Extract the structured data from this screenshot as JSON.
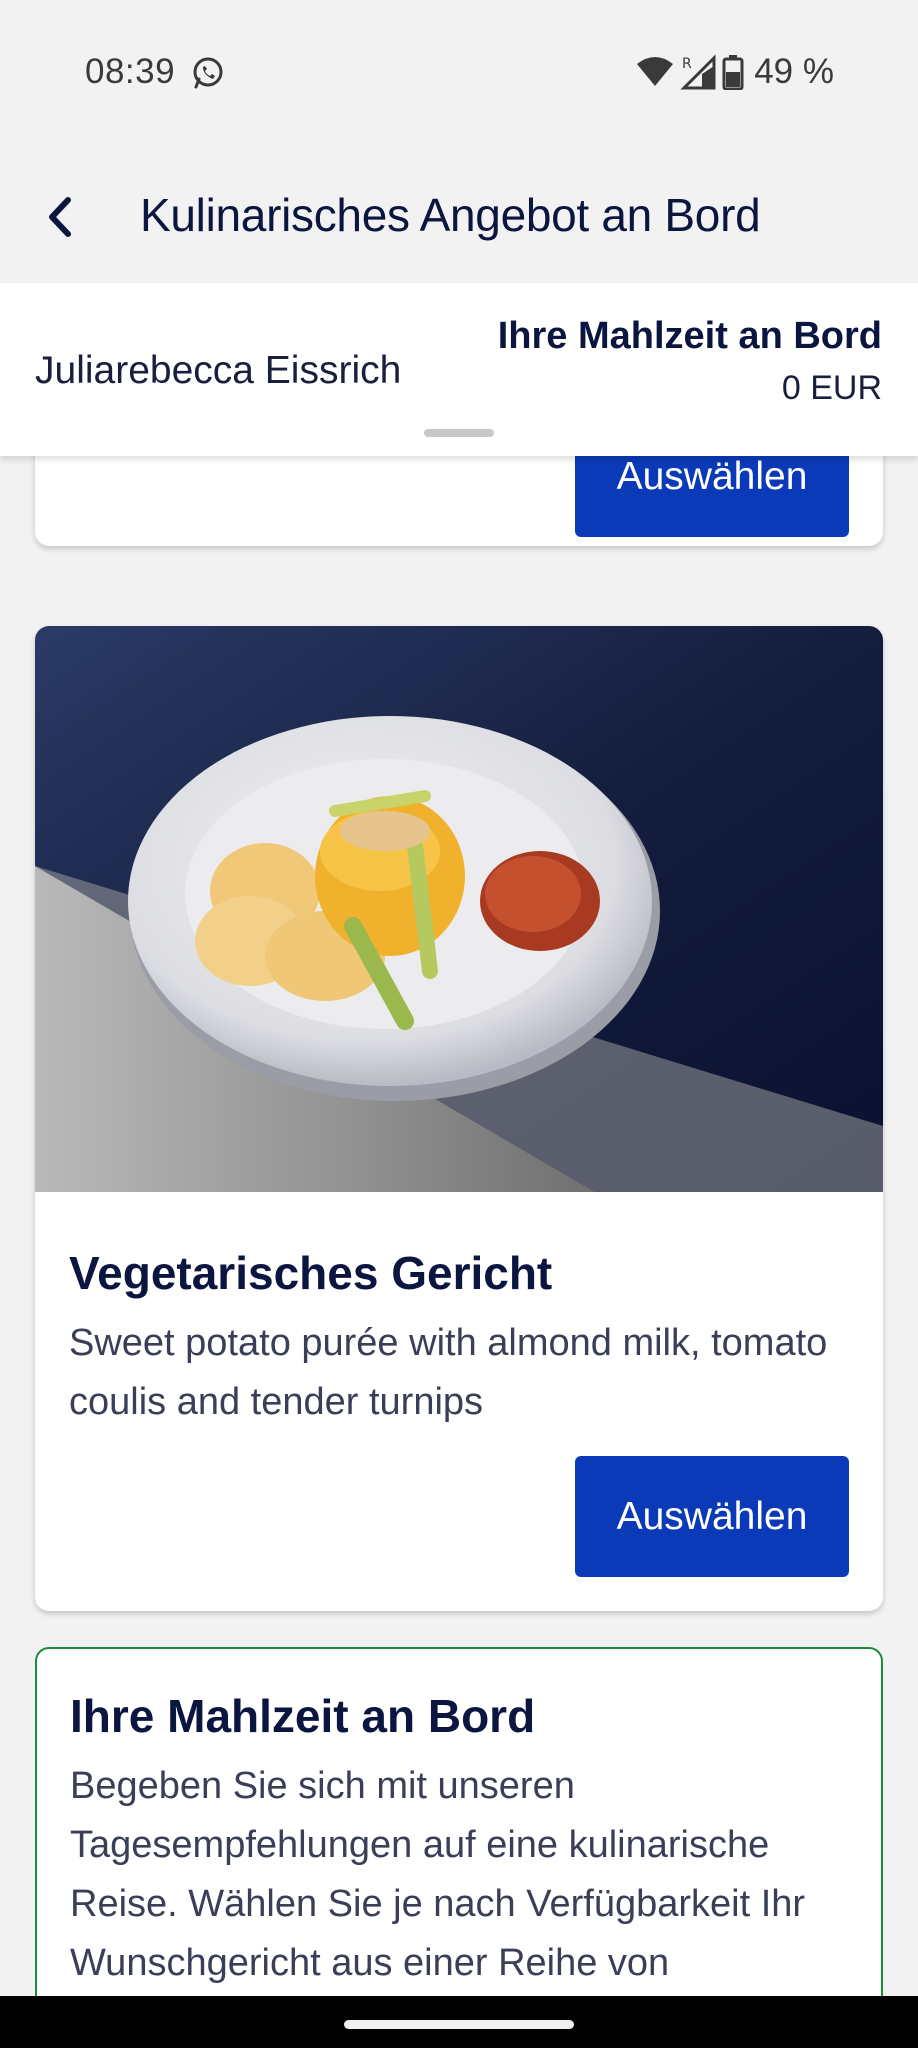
{
  "status_bar": {
    "time": "08:39",
    "battery_percent": "49 %",
    "icons": [
      "whatsapp-icon",
      "wifi-icon",
      "signal-roaming-icon",
      "battery-icon"
    ]
  },
  "app_bar": {
    "title": "Kulinarisches Angebot an Bord",
    "back_icon": "chevron-left-icon"
  },
  "summary": {
    "passenger_name": "Juliarebecca Eissrich",
    "meal_title": "Ihre Mahlzeit an Bord",
    "price": "0 EUR"
  },
  "cards": [
    {
      "button_label": "Auswählen"
    },
    {
      "title": "Vegetarisches Gericht",
      "description": "Sweet potato purée with almond milk, tomato coulis and tender turnips",
      "button_label": "Auswählen"
    }
  ],
  "info": {
    "title": "Ihre Mahlzeit an Bord",
    "text": "Begeben Sie sich mit unseren Tagesempfehlungen auf eine kulinarische Reise. Wählen Sie je nach Verfügbarkeit Ihr Wunschgericht aus einer Reihe von"
  },
  "colors": {
    "primary_button": "#0a3ab8",
    "text_dark": "#0b1640",
    "info_border": "#1f8a3b",
    "background": "#f2f2f2"
  }
}
